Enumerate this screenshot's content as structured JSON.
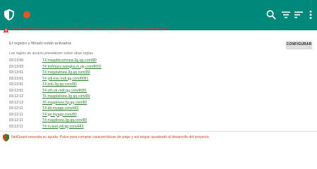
{
  "appbar": {
    "bg_color": "#00897b",
    "icons": [
      "shield-icon",
      "status-dot-icon",
      "search-icon",
      "filter-icon",
      "sort-icon",
      "overflow-menu-icon"
    ]
  },
  "notice": {
    "text": "Tap to grant notification permissions (for access attempt notifications, error messages, etc.)",
    "color": "#e53935"
  },
  "status": {
    "info": "El registro y filtrado están activados",
    "config_button": "CONFIGURAR",
    "subtitle": "Las reglas de acceso prevalecen sobre otras reglas"
  },
  "log": [
    {
      "time": "03:13:50",
      "host": "T4 mayplikcomnew.3g.qq.com/80"
    },
    {
      "time": "03:13:03",
      "host": "T4 tmfmazu.wangka.m.qq.com/8002"
    },
    {
      "time": "03:13:51",
      "host": "T4 mayplatnew.3g.qq.com/80"
    },
    {
      "time": "03:13:51",
      "host": "T4 ydl.eve.mdt.qq.com/8081"
    },
    {
      "time": "03:13:51",
      "host": "T4 info.3g.qq.com/80"
    },
    {
      "time": "03:13:51",
      "host": "T4 oth.str.mdt.qq.com/8081"
    },
    {
      "time": "03:12:12",
      "host": "T6 mayplatnew.3g.qq.com/80"
    },
    {
      "time": "03:12:12",
      "host": "T6 mayplnew.3g.qq.com/80"
    },
    {
      "time": "03:12:11",
      "host": "T4 dd.myapp.com/443"
    },
    {
      "time": "03:12:11",
      "host": "T4 pp.myapp.com/80"
    },
    {
      "time": "03:12:11",
      "host": "T4 mayplnew.3g.qq.com/80"
    },
    {
      "time": "03:12:11",
      "host": "T4 m-test.ydl.qq.com/443"
    }
  ],
  "footer": {
    "text": "NetGuard necesita su ayuda. Pulse para comprar características de pago y así seguir ayudando al desarrollo del proyecto.",
    "color": "#d84315"
  }
}
